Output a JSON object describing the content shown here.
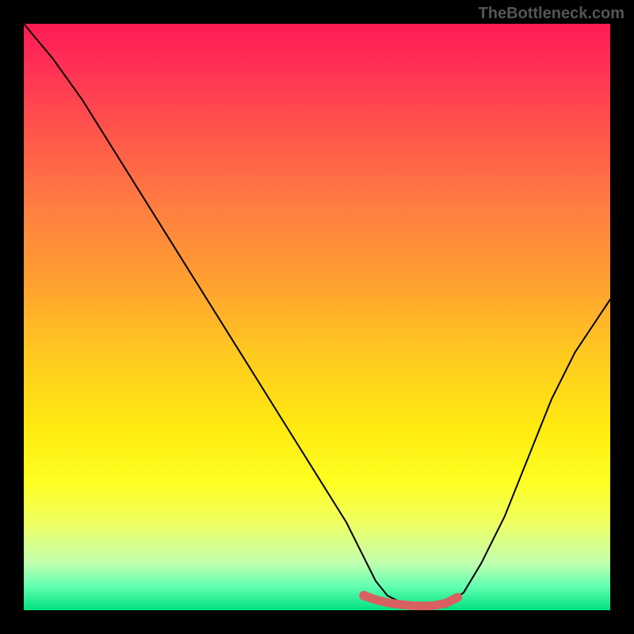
{
  "watermark": "TheBottleneck.com",
  "chart_data": {
    "type": "line",
    "title": "",
    "xlabel": "",
    "ylabel": "",
    "xlim": [
      0,
      100
    ],
    "ylim": [
      0,
      100
    ],
    "grid": false,
    "series": [
      {
        "name": "bottleneck-curve",
        "color": "#000000",
        "x": [
          0,
          5,
          10,
          15,
          20,
          25,
          30,
          35,
          40,
          45,
          50,
          55,
          58,
          60,
          62,
          65,
          68,
          70,
          72,
          75,
          78,
          82,
          86,
          90,
          94,
          98,
          100
        ],
        "y": [
          100,
          94,
          87,
          79,
          71,
          63,
          55,
          47,
          39,
          31,
          23,
          15,
          9,
          5,
          2.5,
          1,
          0.5,
          0.5,
          1,
          3,
          8,
          16,
          26,
          36,
          44,
          50,
          53
        ]
      }
    ],
    "highlight": {
      "name": "optimal-range",
      "color": "#d86060",
      "x": [
        58,
        60,
        62,
        64,
        66,
        68,
        70,
        72,
        74
      ],
      "y": [
        2.5,
        1.8,
        1.3,
        1.0,
        0.8,
        0.7,
        0.8,
        1.2,
        2.2
      ]
    },
    "background_gradient": {
      "type": "vertical",
      "stops": [
        {
          "pos": 0,
          "color": "#ff1a55"
        },
        {
          "pos": 20,
          "color": "#ff5a4a"
        },
        {
          "pos": 44,
          "color": "#ffa030"
        },
        {
          "pos": 68,
          "color": "#ffe810"
        },
        {
          "pos": 85,
          "color": "#f0ff60"
        },
        {
          "pos": 96,
          "color": "#60ffb0"
        },
        {
          "pos": 100,
          "color": "#00e080"
        }
      ]
    }
  }
}
